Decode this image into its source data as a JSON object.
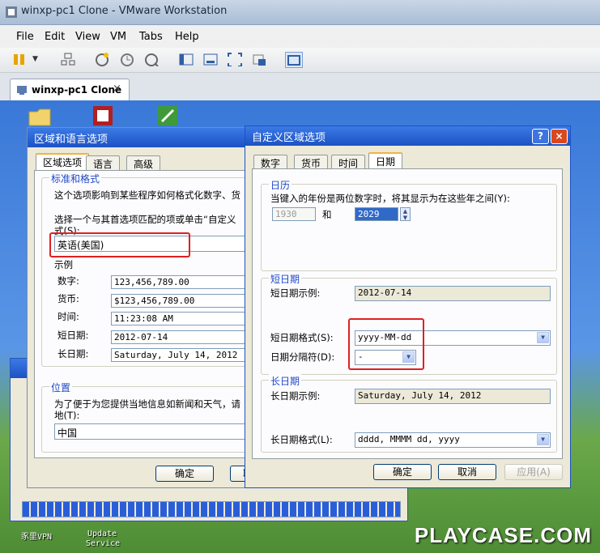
{
  "window": {
    "title": "winxp-pc1 Clone - VMware Workstation"
  },
  "menu": [
    "File",
    "Edit",
    "View",
    "VM",
    "Tabs",
    "Help"
  ],
  "tab": {
    "label": "winxp-pc1 Clone",
    "close": "×"
  },
  "desktop": {
    "icon_labels": [
      "豕里VPN",
      "Update",
      "Service"
    ],
    "watermark": "PLAYCASE.COM"
  },
  "regional": {
    "title": "区域和语言选项",
    "tabs": [
      "区域选项",
      "语言",
      "高级"
    ],
    "standards": {
      "group": "标准和格式",
      "desc": "这个选项影响到某些程序如何格式化数字、货",
      "prompt_1": "选择一个与其首选项匹配的项或单击“自定义",
      "prompt_2": "式(S):",
      "selected": "英语(美国)"
    },
    "samples": {
      "label": "示例",
      "rows": [
        {
          "label": "数字:",
          "value": "123,456,789.00"
        },
        {
          "label": "货币:",
          "value": "$123,456,789.00"
        },
        {
          "label": "时间:",
          "value": "11:23:08 AM"
        },
        {
          "label": "短日期:",
          "value": "2012-07-14"
        },
        {
          "label": "长日期:",
          "value": "Saturday, July 14, 2012"
        }
      ]
    },
    "location": {
      "group": "位置",
      "desc_1": "为了便于为您提供当地信息如新闻和天气，请",
      "desc_2": "地(T):",
      "value": "中国"
    },
    "ok": "确定",
    "cancel": "取"
  },
  "custom": {
    "title": "自定义区域选项",
    "help": "?",
    "close": "×",
    "tabs": [
      "数字",
      "货币",
      "时间",
      "日期"
    ],
    "calendar": {
      "group": "日历",
      "desc": "当键入的年份是两位数字时，将其显示为在这些年之间(Y):",
      "from": "1930",
      "and": "和",
      "to": "2029"
    },
    "short_date": {
      "group": "短日期",
      "sample_label": "短日期示例:",
      "sample": "2012-07-14",
      "format_label": "短日期格式(S):",
      "format": "yyyy-MM-dd",
      "sep_label": "日期分隔符(D):",
      "sep": "-"
    },
    "long_date": {
      "group": "长日期",
      "sample_label": "长日期示例:",
      "sample": "Saturday, July 14, 2012",
      "format_label": "长日期格式(L):",
      "format": "dddd, MMMM dd, yyyy"
    },
    "ok": "确定",
    "cancel": "取消",
    "apply": "应用(A)"
  },
  "colors": {
    "xp_title": "#1c52c4",
    "highlight_box": "#e02020",
    "dialog_bg": "#ece9d8"
  }
}
